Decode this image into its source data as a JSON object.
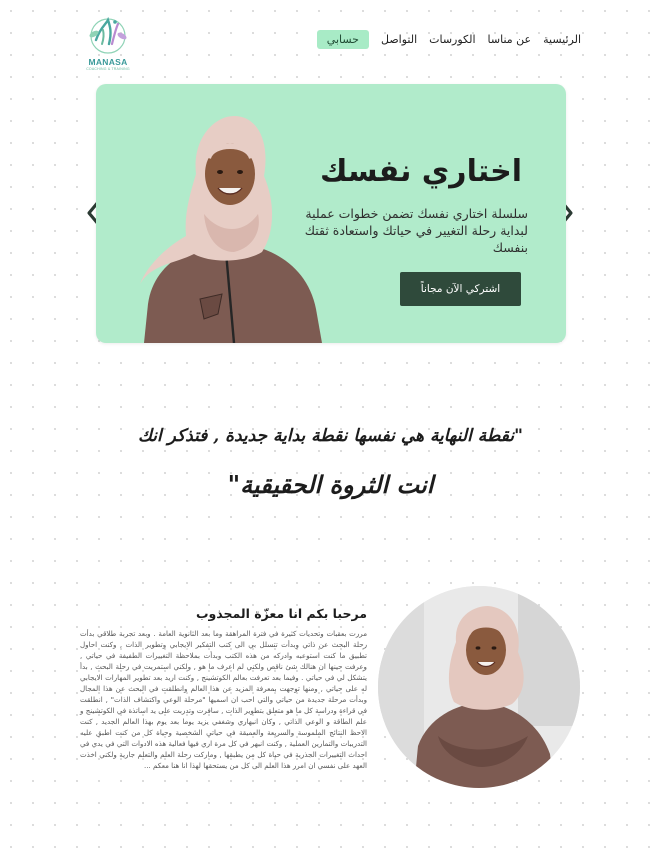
{
  "brand": {
    "name": "MANASA",
    "tagline": "COACHING & TRAINING",
    "colors": {
      "teal": "#3a9a9a",
      "green": "#6abaa0"
    }
  },
  "nav": {
    "account": "حسابي",
    "links": [
      "التواصل",
      "الكورسات",
      "عن مناسا",
      "الرئيسية"
    ]
  },
  "hero": {
    "title": "اختاري نفسك",
    "description": "سلسلة اختاري نفسك تضمن خطوات عملية لبداية رحلة التغيير في حياتك واستعادة ثقتك بنفسك",
    "cta": "اشتركي الآن مجاناً",
    "colors": {
      "background": "#b1ebcb",
      "button": "#2f4a3b"
    },
    "prev_icon": "chevron-left-icon",
    "next_icon": "chevron-right-icon"
  },
  "quote": {
    "line1": "\"نقطة النهاية هي نفسها نقطة بداية جديدة , فتذكر انك",
    "line2": "انت الثروة الحقيقية\""
  },
  "about": {
    "title": "مرحبا بكم انا معزّة المجذوب",
    "body": "مررت بعقبات وتحديات كثيرة في فترة المراهقة وما بعد الثانوية العامة . وبعد تجربة طلاقي بدأت رحلة البحث عن ذاتي وبدأت تتسلل بي الى كتب التفكير الايجابي وتطوير الذات , وكنت احاول تطبيق ما كنت استوعبه وادركه من هذه الكتب وبدأت بملاحظة التغييرات الطفيفة في حياتي , وعرفت حينها ان هنالك شئ ناقص ولكني لم اعرف ما هو , ولكني استمريت في رحلة البحث , بدأ يتشكل لي في حياتي . وفيما بعد تعرفت بعالم الكوتشينج , وكنت اريد بعد تطوير المهارات الايجابي له على حياتي , ومنها توجهت بمعرفة المزيد عن هذا العالم وانطلقت في البحث عن هذا المجال وبدأت مرحلة جديدة من حياتي والتي احب ان اسميها \"مرحلة الوعي واكتشاف الذات\" , انطلقت في قراءة ودراسة كل ما هو متعلق بتطوير الذات , سافرت وتدربت على يد اساتذة في الكوتشينج و علم الطاقة و الوعي الذاتي , وكان انبهاري وشغفي يزيد يوما بعد يوم بهذا العالم الجديد , كنت الاحظ النتائج الملموسة والسريعة والعميقة في حياتي الشخصية وحياة كل من كنت اطبق عليه التدريبات والتمارين العملية , وكنت انبهر في كل مرة اري فيها فعالية هذه الادوات التي في يدي في احداث التغييرات الجذرية في حياة كل من يطبقها , وماركت رحلة العلم والتعلم جارية ولكني اخذت العهد على نفسي ان امرر هذا العلم الى كل من يستحقها لهذا انا هنا معكم ..."
  }
}
